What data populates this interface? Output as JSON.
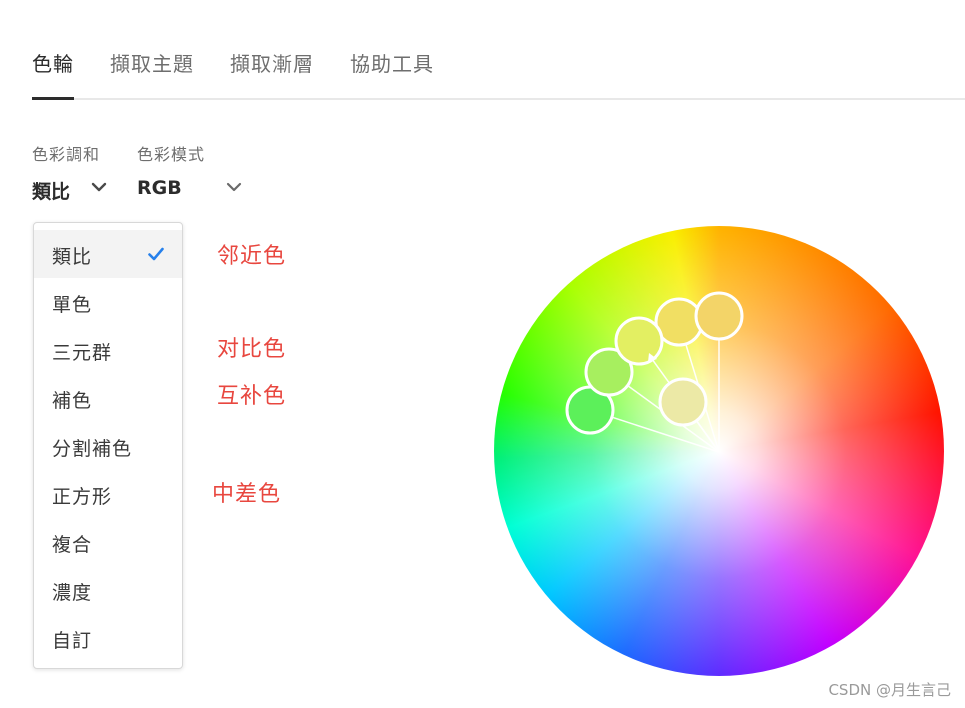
{
  "tabs": [
    {
      "label": "色輪"
    },
    {
      "label": "擷取主題"
    },
    {
      "label": "擷取漸層"
    },
    {
      "label": "協助工具"
    }
  ],
  "harmony": {
    "label": "色彩調和",
    "value": "類比"
  },
  "mode": {
    "label": "色彩模式",
    "value": "RGB"
  },
  "menu": {
    "items": [
      {
        "label": "類比",
        "selected": true
      },
      {
        "label": "單色"
      },
      {
        "label": "三元群"
      },
      {
        "label": "補色"
      },
      {
        "label": "分割補色"
      },
      {
        "label": "正方形"
      },
      {
        "label": "複合"
      },
      {
        "label": "濃度"
      },
      {
        "label": "自訂"
      }
    ]
  },
  "annotations": {
    "a1": "邻近色",
    "a2": "对比色",
    "a3": "互补色",
    "a4": "中差色"
  },
  "colors": {
    "accent": "#2680eb",
    "annotation": "#e8473f",
    "swatches": [
      "#5cf05a",
      "#a7ef5f",
      "#e3ef62",
      "#f1df63",
      "#f3d468",
      "#ece9a6"
    ]
  },
  "watermark": "CSDN @月生言己"
}
